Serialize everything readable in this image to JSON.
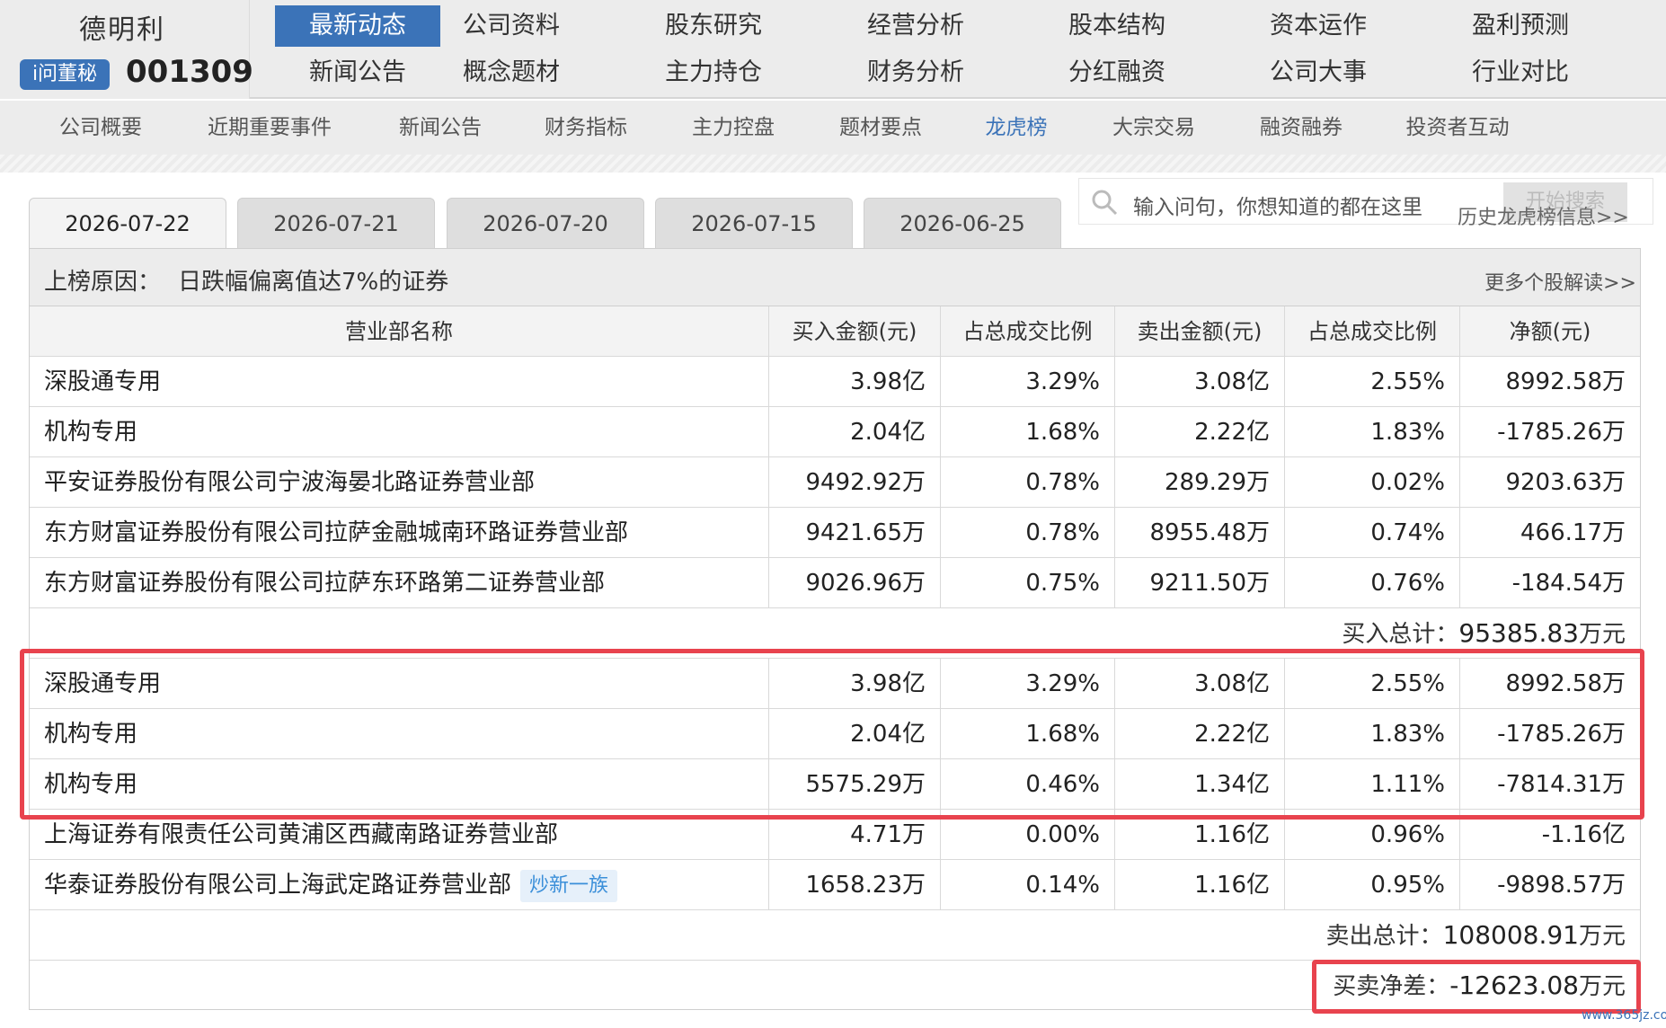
{
  "company": {
    "name": "德明利",
    "badge": "i问董秘",
    "code": "001309"
  },
  "nav": {
    "row1": [
      "最新动态",
      "公司资料",
      "股东研究",
      "经营分析",
      "股本结构",
      "资本运作",
      "盈利预测"
    ],
    "row2": [
      "新闻公告",
      "概念题材",
      "主力持仓",
      "财务分析",
      "分红融资",
      "公司大事",
      "行业对比"
    ],
    "active": "最新动态"
  },
  "subnav": {
    "items": [
      "公司概要",
      "近期重要事件",
      "新闻公告",
      "财务指标",
      "主力控盘",
      "题材要点",
      "龙虎榜",
      "大宗交易",
      "融资融券",
      "投资者互动"
    ],
    "active": "龙虎榜"
  },
  "date_tabs": {
    "items": [
      "2026-07-22",
      "2026-07-21",
      "2026-07-20",
      "2026-07-15",
      "2026-06-25"
    ],
    "active": "2026-07-22"
  },
  "search": {
    "placeholder": "输入问句，你想知道的都在这里",
    "button": "开始搜索"
  },
  "history_link": "历史龙虎榜信息>>",
  "reason": {
    "label": "上榜原因：",
    "value": "日跌幅偏离值达7%的证券",
    "more": "更多个股解读>>"
  },
  "columns": [
    "营业部名称",
    "买入金额(元)",
    "占总成交比例",
    "卖出金额(元)",
    "占总成交比例",
    "净额(元)"
  ],
  "buy_rows": [
    {
      "name": "深股通专用",
      "buy": "3.98亿",
      "buy_pct": "3.29%",
      "sell": "3.08亿",
      "sell_pct": "2.55%",
      "net": "8992.58万"
    },
    {
      "name": "机构专用",
      "buy": "2.04亿",
      "buy_pct": "1.68%",
      "sell": "2.22亿",
      "sell_pct": "1.83%",
      "net": "-1785.26万"
    },
    {
      "name": "平安证券股份有限公司宁波海晏北路证券营业部",
      "buy": "9492.92万",
      "buy_pct": "0.78%",
      "sell": "289.29万",
      "sell_pct": "0.02%",
      "net": "9203.63万"
    },
    {
      "name": "东方财富证券股份有限公司拉萨金融城南环路证券营业部",
      "buy": "9421.65万",
      "buy_pct": "0.78%",
      "sell": "8955.48万",
      "sell_pct": "0.74%",
      "net": "466.17万"
    },
    {
      "name": "东方财富证券股份有限公司拉萨东环路第二证券营业部",
      "buy": "9026.96万",
      "buy_pct": "0.75%",
      "sell": "9211.50万",
      "sell_pct": "0.76%",
      "net": "-184.54万"
    }
  ],
  "buy_total": {
    "label": "买入总计：",
    "value": "95385.83",
    "unit": "万元"
  },
  "sell_rows": [
    {
      "name": "深股通专用",
      "buy": "3.98亿",
      "buy_pct": "3.29%",
      "sell": "3.08亿",
      "sell_pct": "2.55%",
      "net": "8992.58万"
    },
    {
      "name": "机构专用",
      "buy": "2.04亿",
      "buy_pct": "1.68%",
      "sell": "2.22亿",
      "sell_pct": "1.83%",
      "net": "-1785.26万"
    },
    {
      "name": "机构专用",
      "buy": "5575.29万",
      "buy_pct": "0.46%",
      "sell": "1.34亿",
      "sell_pct": "1.11%",
      "net": "-7814.31万"
    },
    {
      "name": "上海证券有限责任公司黄浦区西藏南路证券营业部",
      "buy": "4.71万",
      "buy_pct": "0.00%",
      "sell": "1.16亿",
      "sell_pct": "0.96%",
      "net": "-1.16亿"
    },
    {
      "name": "华泰证券股份有限公司上海武定路证券营业部",
      "tag": "炒新一族",
      "buy": "1658.23万",
      "buy_pct": "0.14%",
      "sell": "1.16亿",
      "sell_pct": "0.95%",
      "net": "-9898.57万"
    }
  ],
  "sell_total": {
    "label": "卖出总计：",
    "value": "108008.91",
    "unit": "万元"
  },
  "net_diff": {
    "label": "买卖净差：",
    "value": "-12623.08",
    "unit": "万元"
  },
  "watermark": "www.365jz.com",
  "colors": {
    "accent": "#3b73b8",
    "highlight": "#e8434e",
    "tag_bg": "#e6f0fa",
    "tag_text": "#3b8fd9"
  }
}
